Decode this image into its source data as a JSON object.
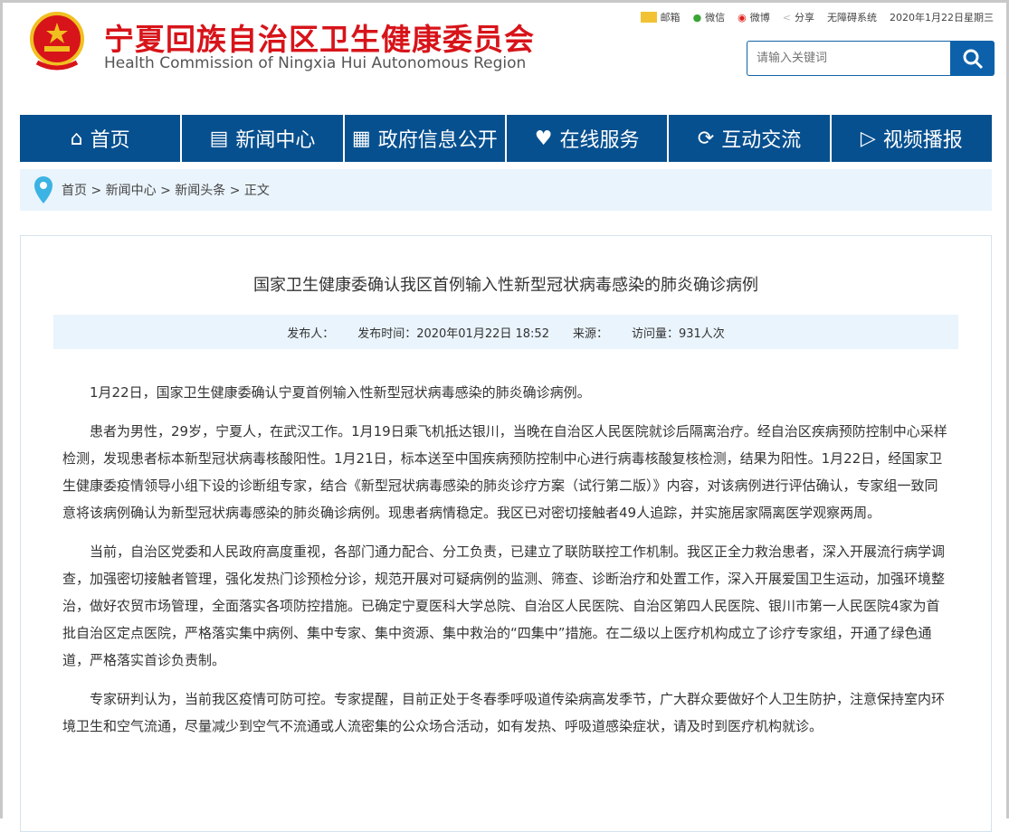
{
  "header": {
    "title_cn": "宁夏回族自治区卫生健康委员会",
    "title_en": "Health Commission of Ningxia Hui Autonomous Region",
    "top_links": [
      "邮箱",
      "微信",
      "微博",
      "分享",
      "无障碍系统"
    ],
    "date": "2020年1月22日星期三",
    "search_placeholder": "请输入关键词"
  },
  "nav": [
    "首页",
    "新闻中心",
    "政府信息公开",
    "在线服务",
    "互动交流",
    "视频播报"
  ],
  "breadcrumb": [
    "首页",
    "新闻中心",
    "新闻头条",
    "正文"
  ],
  "breadcrumb_sep": ">",
  "article": {
    "title": "国家卫生健康委确认我区首例输入性新型冠状病毒感染的肺炎确诊病例",
    "meta": {
      "publisher": "发布人：",
      "time": "发布时间：2020年01月22日 18:52",
      "source": "来源：",
      "views": "访问量：931人次"
    },
    "paragraphs": [
      "1月22日，国家卫生健康委确认宁夏首例输入性新型冠状病毒感染的肺炎确诊病例。",
      "患者为男性，29岁，宁夏人，在武汉工作。1月19日乘飞机抵达银川，当晚在自治区人民医院就诊后隔离治疗。经自治区疾病预防控制中心采样检测，发现患者标本新型冠状病毒核酸阳性。1月21日，标本送至中国疾病预防控制中心进行病毒核酸复核检测，结果为阳性。1月22日，经国家卫生健康委疫情领导小组下设的诊断组专家，结合《新型冠状病毒感染的肺炎诊疗方案（试行第二版）》内容，对该病例进行评估确认，专家组一致同意将该病例确认为新型冠状病毒感染的肺炎确诊病例。现患者病情稳定。我区已对密切接触者49人追踪，并实施居家隔离医学观察两周。",
      "当前，自治区党委和人民政府高度重视，各部门通力配合、分工负责，已建立了联防联控工作机制。我区正全力救治患者，深入开展流行病学调查，加强密切接触者管理，强化发热门诊预检分诊，规范开展对可疑病例的监测、筛查、诊断治疗和处置工作，深入开展爱国卫生运动，加强环境整治，做好农贸市场管理，全面落实各项防控措施。已确定宁夏医科大学总院、自治区人民医院、自治区第四人民医院、银川市第一人民医院4家为首批自治区定点医院，严格落实集中病例、集中专家、集中资源、集中救治的“四集中”措施。在二级以上医疗机构成立了诊疗专家组，开通了绿色通道，严格落实首诊负责制。",
      "专家研判认为，当前我区疫情可防可控。专家提醒，目前正处于冬春季呼吸道传染病高发季节，广大群众要做好个人卫生防护，注意保持室内环境卫生和空气流通，尽量减少到空气不流通或人流密集的公众场合活动，如有发热、呼吸道感染症状，请及时到医疗机构就诊。"
    ]
  },
  "colors": {
    "nav": "#07508f",
    "title_red": "#d7141a",
    "light_bg": "#eaf4fc"
  }
}
